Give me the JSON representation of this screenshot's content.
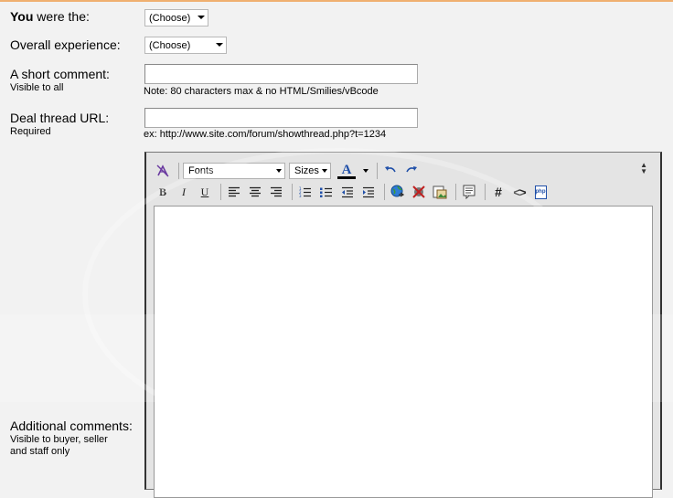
{
  "form": {
    "role": {
      "label_bold": "You",
      "label_rest": " were the:",
      "select_value": "(Choose)"
    },
    "experience": {
      "label": "Overall experience:",
      "select_value": "(Choose)"
    },
    "short_comment": {
      "label": "A short comment:",
      "sublabel": "Visible to all",
      "value": "",
      "note": "Note: 80 characters max & no HTML/Smilies/vBcode"
    },
    "deal_url": {
      "label": "Deal thread URL:",
      "sublabel": "Required",
      "value": "",
      "note": "ex: http://www.site.com/forum/showthread.php?t=1234"
    },
    "additional": {
      "label": "Additional comments:",
      "sublabel_1": "Visible to buyer, seller",
      "sublabel_2": "and staff only"
    }
  },
  "editor": {
    "font_select": "Fonts",
    "size_select": "Sizes",
    "text_color_glyph": "A",
    "bold_glyph": "B",
    "italic_glyph": "I",
    "underline_glyph": "U",
    "hash_glyph": "#",
    "code_glyph": "<>",
    "php_glyph": "php",
    "colors": {
      "text_color_bar": "#000000",
      "icon_blue": "#1f4fa8",
      "icon_purple": "#6a3aa0"
    }
  }
}
